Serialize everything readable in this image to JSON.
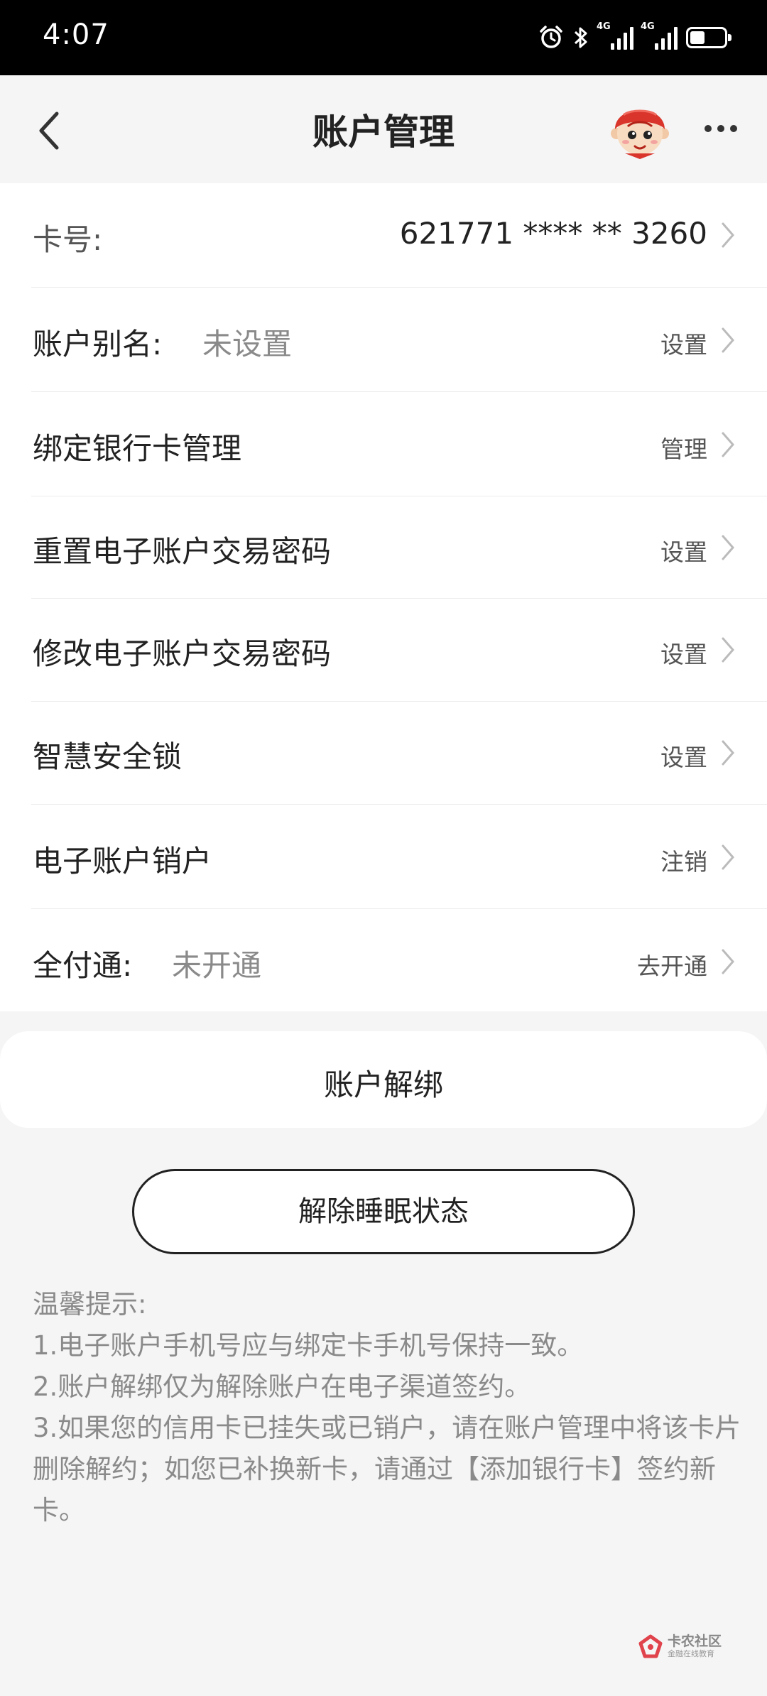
{
  "status_bar": {
    "time": "4:07",
    "network_1": "4G",
    "network_2": "4G",
    "icons": [
      "alarm-icon",
      "bluetooth-icon",
      "signal-icon",
      "signal-icon",
      "battery-icon"
    ]
  },
  "header": {
    "title": "账户管理",
    "back_icon": "back-chevron-icon",
    "more_icon": "more-dots-icon"
  },
  "account": {
    "card_label": "卡号:",
    "card_number": "621771 **** ** 3260",
    "alias_label": "账户别名:",
    "alias_value": "未设置",
    "alias_action": "设置",
    "bind_card_label": "绑定银行卡管理",
    "bind_card_action": "管理",
    "reset_pwd_label": "重置电子账户交易密码",
    "reset_pwd_action": "设置",
    "change_pwd_label": "修改电子账户交易密码",
    "change_pwd_action": "设置",
    "security_lock_label": "智慧安全锁",
    "security_lock_action": "设置",
    "close_account_label": "电子账户销户",
    "close_account_action": "注销",
    "quanfutong_label": "全付通:",
    "quanfutong_value": "未开通",
    "quanfutong_action": "去开通"
  },
  "unbind_label": "账户解绑",
  "wake_button": "解除睡眠状态",
  "tips": {
    "title": "温馨提示:",
    "items": [
      "1.电子账户手机号应与绑定卡手机号保持一致。",
      "2.账户解绑仅为解除账户在电子渠道签约。",
      "3.如果您的信用卡已挂失或已销户，请在账户管理中将该卡片删除解约；如您已补换新卡，请通过【添加银行卡】签约新卡。"
    ]
  },
  "watermark": {
    "text": "卡农社区",
    "sub": "金融在线教育"
  },
  "colors": {
    "background": "#f5f5f5",
    "card": "#ffffff",
    "text": "#222222",
    "muted": "#8a8a8a",
    "chevron": "#bbbbbb",
    "mascot_red": "#d9352b"
  }
}
